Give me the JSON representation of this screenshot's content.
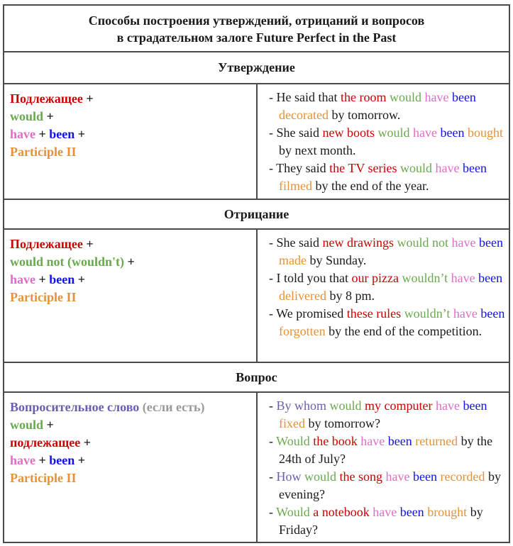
{
  "title": {
    "line1": "Способы построения утверждений, отрицаний и вопросов",
    "line2": "в страдательном залоге Future Perfect in the Past"
  },
  "colors": {
    "subject": "#cc0000",
    "would": "#6aa84f",
    "have": "#e06cc8",
    "been": "#1111ee",
    "participle": "#e69138",
    "question_word": "#6b5eb0",
    "optional_note": "#9a9a9a"
  },
  "sections": [
    {
      "heading": "Утверждение",
      "formula": [
        [
          {
            "t": "Подлежащее",
            "c": "red"
          },
          {
            "t": " +",
            "c": "black"
          }
        ],
        [
          {
            "t": "would",
            "c": "green"
          },
          {
            "t": " +",
            "c": "black"
          }
        ],
        [
          {
            "t": "have",
            "c": "pink"
          },
          {
            "t": " + ",
            "c": "black"
          },
          {
            "t": "been",
            "c": "blue"
          },
          {
            "t": " +",
            "c": "black"
          }
        ],
        [
          {
            "t": "Participle II",
            "c": "orange"
          }
        ]
      ],
      "examples": [
        [
          {
            "t": "- He said that ",
            "c": "black"
          },
          {
            "t": "the room",
            "c": "red"
          },
          {
            "t": " would",
            "c": "green"
          },
          {
            "t": " have",
            "c": "pink"
          },
          {
            "t": " been",
            "c": "blue"
          },
          {
            "t": " decorated",
            "c": "orange"
          },
          {
            "t": " by tomorrow.",
            "c": "black"
          }
        ],
        [
          {
            "t": "- She said ",
            "c": "black"
          },
          {
            "t": "new boots",
            "c": "red"
          },
          {
            "t": " would",
            "c": "green"
          },
          {
            "t": " have",
            "c": "pink"
          },
          {
            "t": " been",
            "c": "blue"
          },
          {
            "t": " bought",
            "c": "orange"
          },
          {
            "t": " by next month.",
            "c": "black"
          }
        ],
        [
          {
            "t": "- They said ",
            "c": "black"
          },
          {
            "t": "the TV series",
            "c": "red"
          },
          {
            "t": " would",
            "c": "green"
          },
          {
            "t": " have",
            "c": "pink"
          },
          {
            "t": " been",
            "c": "blue"
          },
          {
            "t": " filmed",
            "c": "orange"
          },
          {
            "t": " by the end of the year.",
            "c": "black"
          }
        ]
      ]
    },
    {
      "heading": "Отрицание",
      "formula": [
        [
          {
            "t": "Подлежащее",
            "c": "red"
          },
          {
            "t": " +",
            "c": "black"
          }
        ],
        [
          {
            "t": "would not (wouldn't)",
            "c": "green"
          },
          {
            "t": " +",
            "c": "black"
          }
        ],
        [
          {
            "t": "have",
            "c": "pink"
          },
          {
            "t": " + ",
            "c": "black"
          },
          {
            "t": "been",
            "c": "blue"
          },
          {
            "t": " +",
            "c": "black"
          }
        ],
        [
          {
            "t": "Participle II",
            "c": "orange"
          }
        ]
      ],
      "examples": [
        [
          {
            "t": "- She said ",
            "c": "black"
          },
          {
            "t": "new drawings",
            "c": "red"
          },
          {
            "t": " would not",
            "c": "green"
          },
          {
            "t": " have",
            "c": "pink"
          },
          {
            "t": " been",
            "c": "blue"
          },
          {
            "t": " made",
            "c": "orange"
          },
          {
            "t": " by Sunday.",
            "c": "black"
          }
        ],
        [
          {
            "t": "- I told you that ",
            "c": "black"
          },
          {
            "t": "our pizza",
            "c": "red"
          },
          {
            "t": " wouldn’t",
            "c": "green"
          },
          {
            "t": " have",
            "c": "pink"
          },
          {
            "t": " been",
            "c": "blue"
          },
          {
            "t": " delivered",
            "c": "orange"
          },
          {
            "t": " by 8 pm.",
            "c": "black"
          }
        ],
        [
          {
            "t": "- We promised ",
            "c": "black"
          },
          {
            "t": "these rules",
            "c": "red"
          },
          {
            "t": " wouldn’t",
            "c": "green"
          },
          {
            "t": " have",
            "c": "pink"
          },
          {
            "t": " been",
            "c": "blue"
          },
          {
            "t": " forgotten",
            "c": "orange"
          },
          {
            "t": " by the end of the competition.",
            "c": "black"
          }
        ]
      ]
    },
    {
      "heading": "Вопрос",
      "formula": [
        [
          {
            "t": "Вопросительное слово",
            "c": "purple"
          },
          {
            "t": " (если есть)",
            "c": "grey"
          }
        ],
        [
          {
            "t": "would",
            "c": "green"
          },
          {
            "t": " +",
            "c": "black"
          }
        ],
        [
          {
            "t": "подлежащее",
            "c": "red"
          },
          {
            "t": " +",
            "c": "black"
          }
        ],
        [
          {
            "t": "have",
            "c": "pink"
          },
          {
            "t": " + ",
            "c": "black"
          },
          {
            "t": "been",
            "c": "blue"
          },
          {
            "t": " +",
            "c": "black"
          }
        ],
        [
          {
            "t": "Participle II",
            "c": "orange"
          }
        ]
      ],
      "examples": [
        [
          {
            "t": "- ",
            "c": "black"
          },
          {
            "t": "By whom",
            "c": "purple"
          },
          {
            "t": " would",
            "c": "green"
          },
          {
            "t": " my computer",
            "c": "red"
          },
          {
            "t": " have",
            "c": "pink"
          },
          {
            "t": " been",
            "c": "blue"
          },
          {
            "t": " fixed",
            "c": "orange"
          },
          {
            "t": " by tomorrow?",
            "c": "black"
          }
        ],
        [
          {
            "t": "- ",
            "c": "black"
          },
          {
            "t": "Would",
            "c": "green"
          },
          {
            "t": " the book",
            "c": "red"
          },
          {
            "t": " have",
            "c": "pink"
          },
          {
            "t": " been",
            "c": "blue"
          },
          {
            "t": " returned",
            "c": "orange"
          },
          {
            "t": " by the 24th of July?",
            "c": "black"
          }
        ],
        [
          {
            "t": "- ",
            "c": "black"
          },
          {
            "t": "How",
            "c": "purple"
          },
          {
            "t": " would",
            "c": "green"
          },
          {
            "t": " the song",
            "c": "red"
          },
          {
            "t": " have",
            "c": "pink"
          },
          {
            "t": " been",
            "c": "blue"
          },
          {
            "t": " recorded",
            "c": "orange"
          },
          {
            "t": " by evening?",
            "c": "black"
          }
        ],
        [
          {
            "t": "- ",
            "c": "black"
          },
          {
            "t": "Would",
            "c": "green"
          },
          {
            "t": " a notebook",
            "c": "red"
          },
          {
            "t": " have",
            "c": "pink"
          },
          {
            "t": " been",
            "c": "blue"
          },
          {
            "t": " brought",
            "c": "orange"
          },
          {
            "t": " by Friday?",
            "c": "black"
          }
        ]
      ]
    }
  ]
}
